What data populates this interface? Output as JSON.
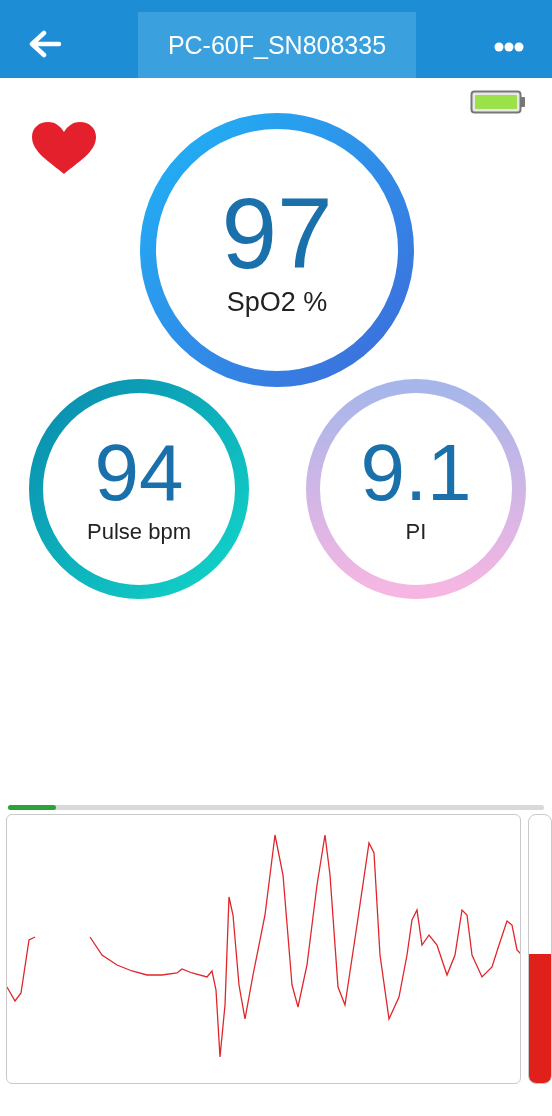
{
  "header": {
    "title": "PC-60F_SN808335"
  },
  "metrics": [
    {
      "kind": "main",
      "value": "97",
      "label": "SpO2 %"
    },
    {
      "kind": "side",
      "value": "94",
      "label": "Pulse bpm"
    },
    {
      "kind": "side",
      "value": "9.1",
      "label": "PI"
    }
  ],
  "waveform": {
    "progress": {
      "level": 0.09
    },
    "signal": {
      "level": 0.48
    }
  }
}
